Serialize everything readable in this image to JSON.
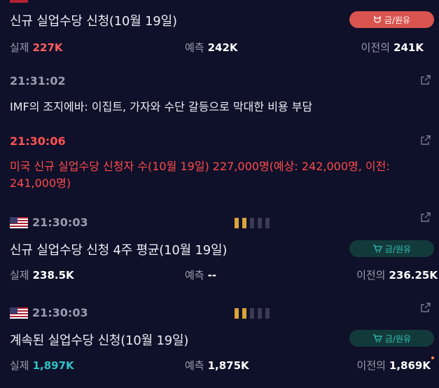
{
  "items": [
    {
      "title": "신규 실업수당 신청(10월 19일)",
      "badge": "금/원유",
      "actual_label": "실제",
      "actual_value": "227K",
      "forecast_label": "예측",
      "forecast_value": "242K",
      "previous_label": "이전의",
      "previous_value": "241K"
    },
    {
      "time": "21:31:02",
      "text": "IMF의 조지에바: 이집트, 가자와 수단 갈등으로 막대한 비용 부담"
    },
    {
      "time": "21:30:06",
      "text": "미국 신규 실업수당 신청자 수(10월 19일) 227,000명(예상: 242,000명, 이전: 241,000명)"
    },
    {
      "time": "21:30:03",
      "title": "신규 실업수당 신청 4주 평균(10월 19일)",
      "badge": "금/원유",
      "actual_label": "실제",
      "actual_value": "238.5K",
      "forecast_label": "예측",
      "forecast_value": "--",
      "previous_label": "이전의",
      "previous_value": "236.25K",
      "importance": 2
    },
    {
      "time": "21:30:03",
      "title": "계속된 실업수당 신청(10월 19일)",
      "badge": "금/원유",
      "actual_label": "실제",
      "actual_value": "1,897K",
      "forecast_label": "예측",
      "forecast_value": "1,875K",
      "previous_label": "이전의",
      "previous_value": "1,869K",
      "importance": 2
    }
  ],
  "colors": {
    "background": "#0f1029",
    "negative": "#ff5252",
    "positive": "#2ec3c6",
    "badge_red": "#d9534f",
    "badge_green": "#133a3b",
    "importance_on": "#d9a43a"
  },
  "icons": [
    "flag-us-icon",
    "external-link-icon",
    "bull-icon",
    "cart-icon"
  ]
}
